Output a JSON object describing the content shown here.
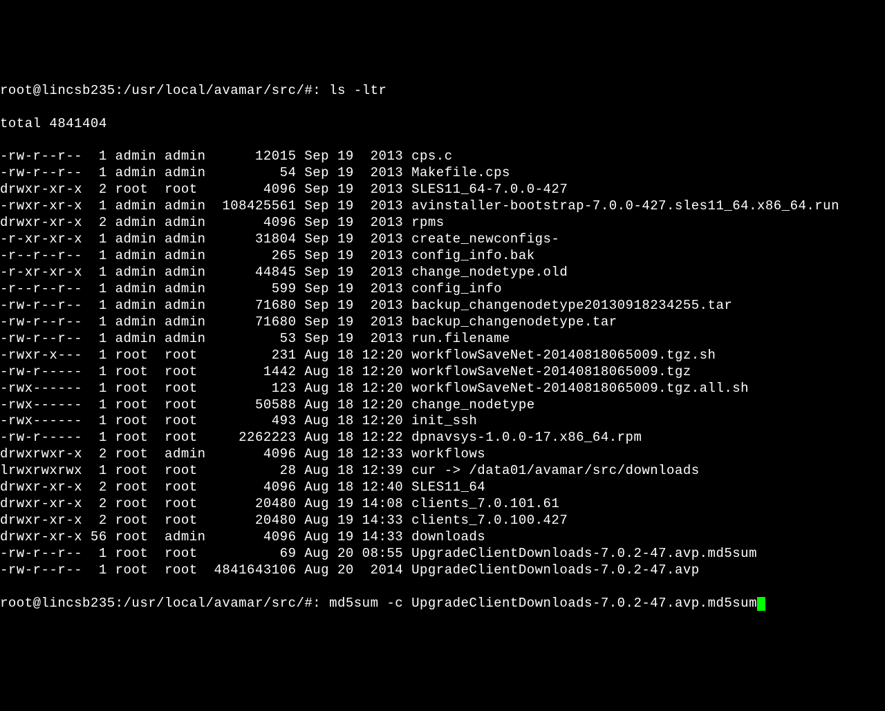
{
  "prompt1": "root@lincsb235:/usr/local/avamar/src/#: ",
  "command1": "ls -ltr",
  "total_line": "total 4841404",
  "entries": [
    {
      "perms": "-rw-r--r--",
      "links": " 1",
      "owner": "admin",
      "group": "admin",
      "size": "     12015",
      "date": "Sep 19  2013",
      "name": "cps.c"
    },
    {
      "perms": "-rw-r--r--",
      "links": " 1",
      "owner": "admin",
      "group": "admin",
      "size": "        54",
      "date": "Sep 19  2013",
      "name": "Makefile.cps"
    },
    {
      "perms": "drwxr-xr-x",
      "links": " 2",
      "owner": "root ",
      "group": "root ",
      "size": "      4096",
      "date": "Sep 19  2013",
      "name": "SLES11_64-7.0.0-427"
    },
    {
      "perms": "-rwxr-xr-x",
      "links": " 1",
      "owner": "admin",
      "group": "admin",
      "size": " 108425561",
      "date": "Sep 19  2013",
      "name": "avinstaller-bootstrap-7.0.0-427.sles11_64.x86_64.run"
    },
    {
      "perms": "drwxr-xr-x",
      "links": " 2",
      "owner": "admin",
      "group": "admin",
      "size": "      4096",
      "date": "Sep 19  2013",
      "name": "rpms"
    },
    {
      "perms": "-r-xr-xr-x",
      "links": " 1",
      "owner": "admin",
      "group": "admin",
      "size": "     31804",
      "date": "Sep 19  2013",
      "name": "create_newconfigs-"
    },
    {
      "perms": "-r--r--r--",
      "links": " 1",
      "owner": "admin",
      "group": "admin",
      "size": "       265",
      "date": "Sep 19  2013",
      "name": "config_info.bak"
    },
    {
      "perms": "-r-xr-xr-x",
      "links": " 1",
      "owner": "admin",
      "group": "admin",
      "size": "     44845",
      "date": "Sep 19  2013",
      "name": "change_nodetype.old"
    },
    {
      "perms": "-r--r--r--",
      "links": " 1",
      "owner": "admin",
      "group": "admin",
      "size": "       599",
      "date": "Sep 19  2013",
      "name": "config_info"
    },
    {
      "perms": "-rw-r--r--",
      "links": " 1",
      "owner": "admin",
      "group": "admin",
      "size": "     71680",
      "date": "Sep 19  2013",
      "name": "backup_changenodetype20130918234255.tar"
    },
    {
      "perms": "-rw-r--r--",
      "links": " 1",
      "owner": "admin",
      "group": "admin",
      "size": "     71680",
      "date": "Sep 19  2013",
      "name": "backup_changenodetype.tar"
    },
    {
      "perms": "-rw-r--r--",
      "links": " 1",
      "owner": "admin",
      "group": "admin",
      "size": "        53",
      "date": "Sep 19  2013",
      "name": "run.filename"
    },
    {
      "perms": "-rwxr-x---",
      "links": " 1",
      "owner": "root ",
      "group": "root ",
      "size": "       231",
      "date": "Aug 18 12:20",
      "name": "workflowSaveNet-20140818065009.tgz.sh"
    },
    {
      "perms": "-rw-r-----",
      "links": " 1",
      "owner": "root ",
      "group": "root ",
      "size": "      1442",
      "date": "Aug 18 12:20",
      "name": "workflowSaveNet-20140818065009.tgz"
    },
    {
      "perms": "-rwx------",
      "links": " 1",
      "owner": "root ",
      "group": "root ",
      "size": "       123",
      "date": "Aug 18 12:20",
      "name": "workflowSaveNet-20140818065009.tgz.all.sh"
    },
    {
      "perms": "-rwx------",
      "links": " 1",
      "owner": "root ",
      "group": "root ",
      "size": "     50588",
      "date": "Aug 18 12:20",
      "name": "change_nodetype"
    },
    {
      "perms": "-rwx------",
      "links": " 1",
      "owner": "root ",
      "group": "root ",
      "size": "       493",
      "date": "Aug 18 12:20",
      "name": "init_ssh"
    },
    {
      "perms": "-rw-r-----",
      "links": " 1",
      "owner": "root ",
      "group": "root ",
      "size": "   2262223",
      "date": "Aug 18 12:22",
      "name": "dpnavsys-1.0.0-17.x86_64.rpm"
    },
    {
      "perms": "drwxrwxr-x",
      "links": " 2",
      "owner": "root ",
      "group": "admin",
      "size": "      4096",
      "date": "Aug 18 12:33",
      "name": "workflows"
    },
    {
      "perms": "lrwxrwxrwx",
      "links": " 1",
      "owner": "root ",
      "group": "root ",
      "size": "        28",
      "date": "Aug 18 12:39",
      "name": "cur -> /data01/avamar/src/downloads"
    },
    {
      "perms": "drwxr-xr-x",
      "links": " 2",
      "owner": "root ",
      "group": "root ",
      "size": "      4096",
      "date": "Aug 18 12:40",
      "name": "SLES11_64"
    },
    {
      "perms": "drwxr-xr-x",
      "links": " 2",
      "owner": "root ",
      "group": "root ",
      "size": "     20480",
      "date": "Aug 19 14:08",
      "name": "clients_7.0.101.61"
    },
    {
      "perms": "drwxr-xr-x",
      "links": " 2",
      "owner": "root ",
      "group": "root ",
      "size": "     20480",
      "date": "Aug 19 14:33",
      "name": "clients_7.0.100.427"
    },
    {
      "perms": "drwxr-xr-x",
      "links": "56",
      "owner": "root ",
      "group": "admin",
      "size": "      4096",
      "date": "Aug 19 14:33",
      "name": "downloads"
    },
    {
      "perms": "-rw-r--r--",
      "links": " 1",
      "owner": "root ",
      "group": "root ",
      "size": "        69",
      "date": "Aug 20 08:55",
      "name": "UpgradeClientDownloads-7.0.2-47.avp.md5sum"
    },
    {
      "perms": "-rw-r--r--",
      "links": " 1",
      "owner": "root ",
      "group": "root ",
      "size": "4841643106",
      "date": "Aug 20  2014",
      "name": "UpgradeClientDownloads-7.0.2-47.avp"
    }
  ],
  "prompt2": "root@lincsb235:/usr/local/avamar/src/#: ",
  "command2": "md5sum -c UpgradeClientDownloads-7.0.2-47.avp.md5sum"
}
